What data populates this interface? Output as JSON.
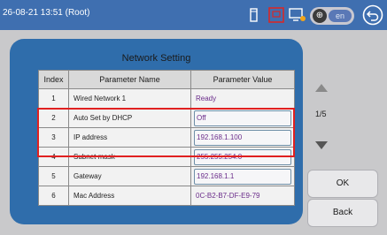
{
  "statusbar": {
    "datetime": "26-08-21 13:51 (Root)",
    "language": "en",
    "icons": [
      "device-icon",
      "alarm-icon",
      "network-icon",
      "globe-icon",
      "back-icon"
    ]
  },
  "panel": {
    "title": "Network Setting",
    "headers": {
      "index": "Index",
      "name": "Parameter Name",
      "value": "Parameter Value"
    },
    "rows": [
      {
        "index": "1",
        "name": "Wired Network 1",
        "value": "Ready"
      },
      {
        "index": "2",
        "name": "Auto Set by DHCP",
        "value": "Off"
      },
      {
        "index": "3",
        "name": "IP address",
        "value": "192.168.1.100"
      },
      {
        "index": "4",
        "name": "Subnet mask",
        "value": "255.255.254.0"
      },
      {
        "index": "5",
        "name": "Gateway",
        "value": "192.168.1.1"
      },
      {
        "index": "6",
        "name": "Mac Address",
        "value": "0C-B2-B7-DF-E9-79"
      }
    ]
  },
  "pager": {
    "page": "1/5"
  },
  "buttons": {
    "ok": "OK",
    "back": "Back"
  },
  "colors": {
    "topbar": "#3f6fb0",
    "panel": "#2f6dab",
    "value_text": "#6a2c8a",
    "highlight": "#e02020"
  }
}
